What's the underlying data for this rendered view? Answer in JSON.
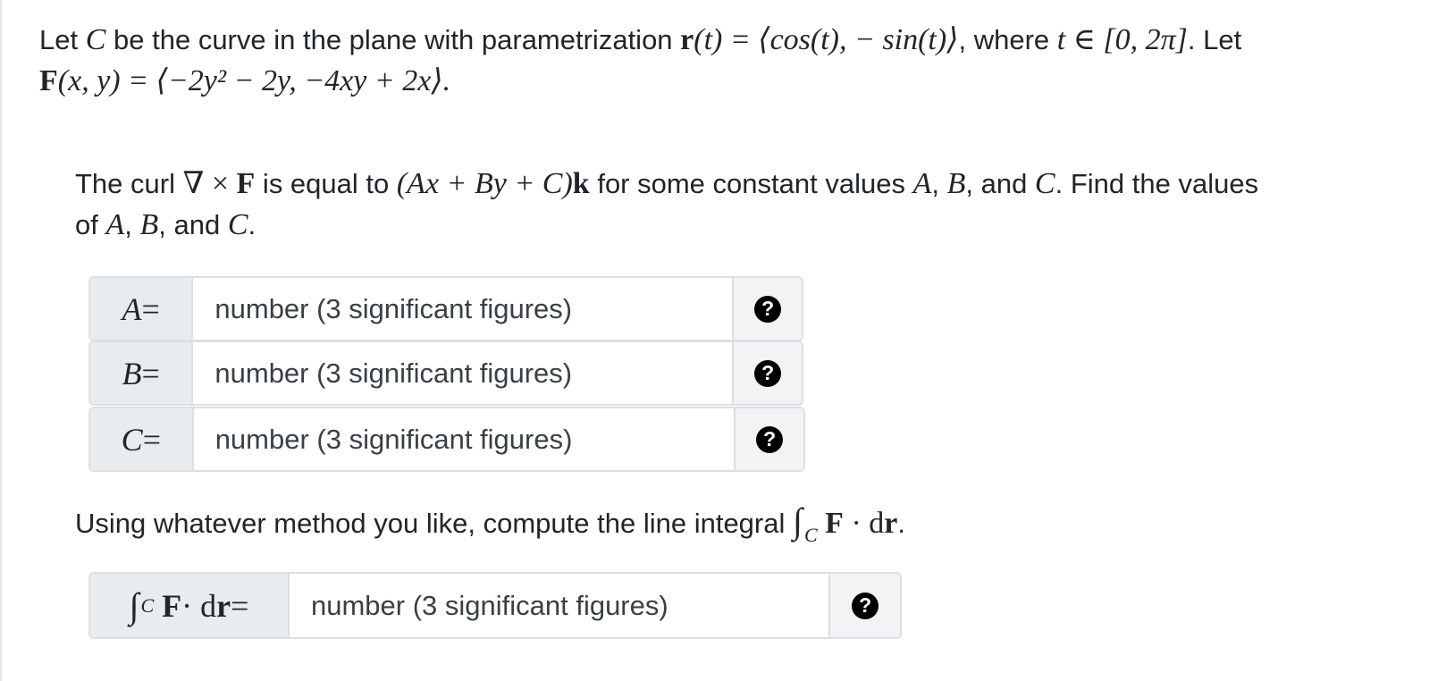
{
  "intro": {
    "line1_text_a": "Let ",
    "curve_var": "C",
    "line1_text_b": " be the curve in the plane with parametrization ",
    "param_lhs": "r",
    "param_expr": "(t) = ⟨cos(t), − sin(t)⟩",
    "line1_text_c": ", where ",
    "t_domain": "t ∈ [0, 2π]",
    "line1_text_d": ". Let",
    "field_name": "F",
    "field_expr": "(x, y) = ⟨−2y² − 2y, −4xy + 2x⟩."
  },
  "curl_question": {
    "text_a": "The curl ",
    "curl_expr": "∇ × ",
    "curl_F": "F",
    "text_b": " is equal to ",
    "form_expr": "(Ax + By + C)",
    "form_k": "k",
    "text_c": " for some constant values ",
    "vars_a": "A",
    "comma1": ", ",
    "vars_b": "B",
    "text_and": ", and ",
    "vars_c": "C",
    "text_d": ". Find the values",
    "text_e": "of ",
    "text_f": ", and ",
    "text_g": "."
  },
  "answers": [
    {
      "label": "A",
      "eq": " =",
      "placeholder": "number (3 significant figures)",
      "help": "?"
    },
    {
      "label": "B",
      "eq": " =",
      "placeholder": "number (3 significant figures)",
      "help": "?"
    },
    {
      "label": "C",
      "eq": " =",
      "placeholder": "number (3 significant figures)",
      "help": "?"
    }
  ],
  "line_integral_question": {
    "text": "Using whatever method you like, compute the line integral ",
    "integral": "∫",
    "sub": "C",
    "expr_F": "F",
    "expr_dot": " · d",
    "expr_r": "r",
    "period": "."
  },
  "integral_answer": {
    "integral": "∫",
    "sub": "C",
    "expr_F": "F",
    "expr_dot": " · d",
    "expr_r": "r",
    "eq": " =",
    "placeholder": "number (3 significant figures)",
    "help": "?"
  }
}
